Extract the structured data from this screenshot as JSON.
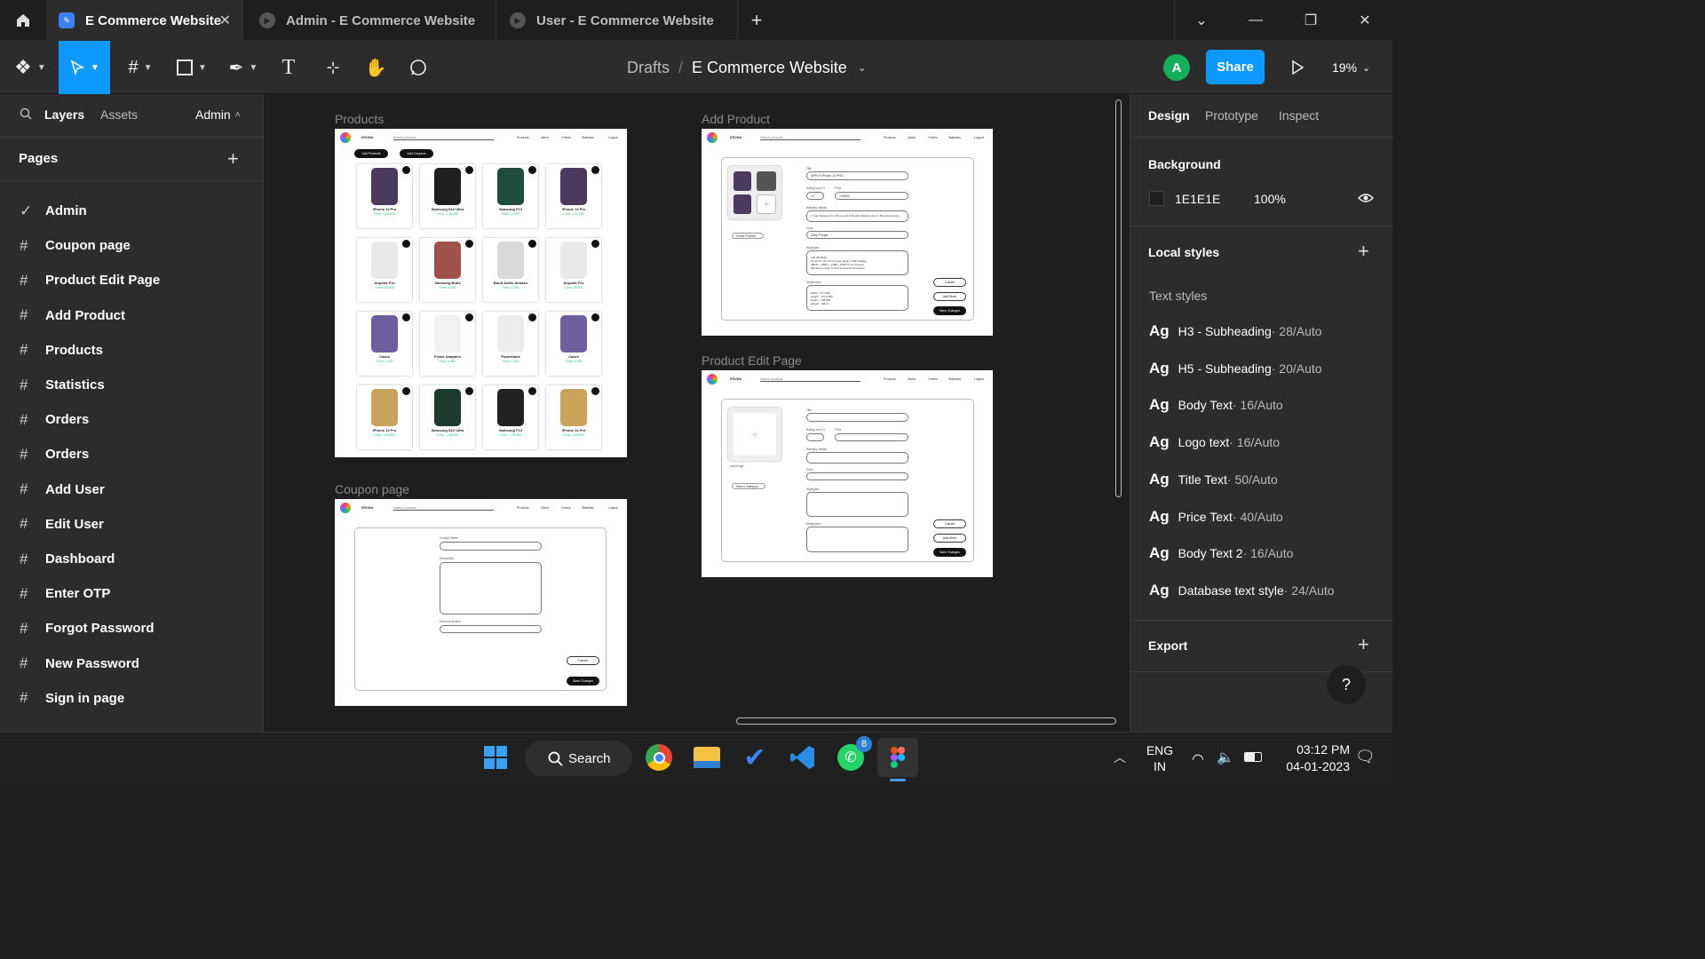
{
  "window": {
    "tabs": [
      {
        "label": "E Commerce Website",
        "active": true
      },
      {
        "label": "Admin - E Commerce Website",
        "active": false
      },
      {
        "label": "User - E Commerce Website",
        "active": false
      }
    ]
  },
  "toolbar": {
    "breadcrumb_root": "Drafts",
    "breadcrumb_sep": "/",
    "file_name": "E Commerce Website",
    "avatar_initial": "A",
    "share_label": "Share",
    "zoom": "19%"
  },
  "left_panel": {
    "tabs": {
      "layers": "Layers",
      "assets": "Assets",
      "page_switch": "Admin"
    },
    "pages_title": "Pages",
    "pages": [
      {
        "label": "Admin",
        "current": true
      },
      {
        "label": "Coupon page"
      },
      {
        "label": "Product Edit Page"
      },
      {
        "label": "Add Product"
      },
      {
        "label": "Products"
      },
      {
        "label": "Statistics"
      },
      {
        "label": "Orders"
      },
      {
        "label": "Orders"
      },
      {
        "label": "Add User"
      },
      {
        "label": "Edit User"
      },
      {
        "label": "Dashboard"
      },
      {
        "label": "Enter OTP"
      },
      {
        "label": "Forgot Password"
      },
      {
        "label": "New Password"
      },
      {
        "label": "Sign in page"
      }
    ]
  },
  "canvas": {
    "frames": {
      "products": "Products",
      "add_product": "Add Product",
      "product_edit": "Product Edit Page",
      "coupon": "Coupon page"
    },
    "mini_nav": {
      "brand": "KROMA",
      "search": "Search products",
      "links": [
        "Products",
        "Users",
        "Orders",
        "Statistics",
        "Logout"
      ]
    },
    "products_frame": {
      "buttons": [
        "Add Products",
        "Add Coupons"
      ],
      "cards": [
        {
          "name": "iPhone 14 Pro",
          "price": "From: 1,29,900",
          "color": "#4c3a5e"
        },
        {
          "name": "Samsung S22 Ultra",
          "price": "From: 1,18,999",
          "color": "#1f1f1f"
        },
        {
          "name": "Samsung F13",
          "price": "From: 11,999",
          "color": "#1e4d3b"
        },
        {
          "name": "iPhone 14 Pro",
          "price": "From: 1,29,900",
          "color": "#4c3a5e"
        },
        {
          "name": "Airpods Pro",
          "price": "From: 26,900",
          "color": "#e9e9e9"
        },
        {
          "name": "Samsung Buds",
          "price": "From: 6,099",
          "color": "#a0524a"
        },
        {
          "name": "Boult Audio Airbass",
          "price": "From: 1,399",
          "color": "#d9d9d9"
        },
        {
          "name": "Airpods Pro",
          "price": "From: 26,900",
          "color": "#e9e9e9"
        },
        {
          "name": "Cases",
          "price": "From: 1,000",
          "color": "#6d5ea0"
        },
        {
          "name": "Power Adapters",
          "price": "From: 1,800",
          "color": "#f1f1f1"
        },
        {
          "name": "Powerbank",
          "price": "From: 1,200",
          "color": "#ececec"
        },
        {
          "name": "Cases",
          "price": "From: 1,000",
          "color": "#6d5ea0"
        },
        {
          "name": "iPhone 14 Pro",
          "price": "From: 1,29,900",
          "color": "#c9a35a"
        },
        {
          "name": "Samsung S22 Ultra",
          "price": "From: 1,29,900",
          "color": "#1d3a2e"
        },
        {
          "name": "Samsung F13",
          "price": "From: 1,29,900",
          "color": "#222"
        },
        {
          "name": "iPhone 14 Pro",
          "price": "From: 1,29,900",
          "color": "#c9a35a"
        }
      ]
    },
    "add_product_frame": {
      "fields": {
        "title_label": "Title",
        "title_value": "APPLE iPhone 14 PRO",
        "rating_label": "Rating out of 5",
        "rating_value": "4.7",
        "price_label": "Price",
        "price_value": "129000",
        "warranty_label": "Warranty details",
        "warranty_value": "1 Year Warranty For Phone And 6 Months Warranty For In Box Accessories",
        "color_label": "Color",
        "color_value": "Deep Purple",
        "highlights_label": "Highlights",
        "highlights_lines": [
          "128 GB ROM",
          "15.49 Cm (6.1 Inch) Super Retina XDR Display",
          "48MP + 12MP + 12MP | 12MP Front Camera",
          "A16 Bionic Chip, 6 Core Processor Processor"
        ],
        "dimensions_label": "Dimensions",
        "dimensions_lines": [
          "Width : 71.5 MM",
          "Height : 147.5 MM",
          "Depth : 7.85 MM",
          "Weight : 206 G"
        ],
        "category_select": "Smart Phones"
      },
      "buttons": {
        "cancel": "Cancel",
        "add_more": "Add More",
        "save": "Save Changes"
      }
    },
    "edit_frame": {
      "title_label": "Title",
      "rating_label": "Rating out of 5",
      "price_label": "Price",
      "warranty_label": "Warranty details",
      "color_label": "Color",
      "highlights_label": "Highlights",
      "dimensions_label": "Dimensions",
      "add_image": "Add Image",
      "category_select": "Select Category",
      "buttons": {
        "cancel": "Cancel",
        "add_more": "Add More",
        "save": "Save Changes"
      }
    },
    "coupon_frame": {
      "name_label": "Coupon Name",
      "desc_label": "Description",
      "discount_label": "Discount amount",
      "cancel": "Cancel",
      "save": "Save Changes"
    }
  },
  "right_panel": {
    "tabs": [
      "Design",
      "Prototype",
      "Inspect"
    ],
    "background_title": "Background",
    "bg_hex": "1E1E1E",
    "bg_opacity": "100%",
    "local_styles_title": "Local styles",
    "text_styles_title": "Text styles",
    "text_styles": [
      {
        "ag": "Ag",
        "name": "H3 - Subheading",
        "meta": " · 28/Auto"
      },
      {
        "ag": "Ag",
        "name": "H5 - Subheading",
        "meta": " · 20/Auto"
      },
      {
        "ag": "Ag",
        "name": "Body Text",
        "meta": " · 16/Auto"
      },
      {
        "ag": "Ag",
        "name": "Logo text",
        "meta": " · 16/Auto"
      },
      {
        "ag": "Ag",
        "name": "Title Text",
        "meta": " · 50/Auto"
      },
      {
        "ag": "Ag",
        "name": "Price Text",
        "meta": " · 40/Auto"
      },
      {
        "ag": "Ag",
        "name": "Body Text 2",
        "meta": " · 16/Auto"
      },
      {
        "ag": "Ag",
        "name": "Database text style",
        "meta": " · 24/Auto"
      }
    ],
    "export_title": "Export",
    "help": "?"
  },
  "taskbar": {
    "search": "Search",
    "whatsapp_badge": "8",
    "lang": "ENG",
    "region": "IN",
    "time": "03:12 PM",
    "date": "04-01-2023"
  },
  "colors": {
    "accent": "#0d99ff",
    "avatar": "#14ae5c",
    "price_green": "#22c55e"
  }
}
